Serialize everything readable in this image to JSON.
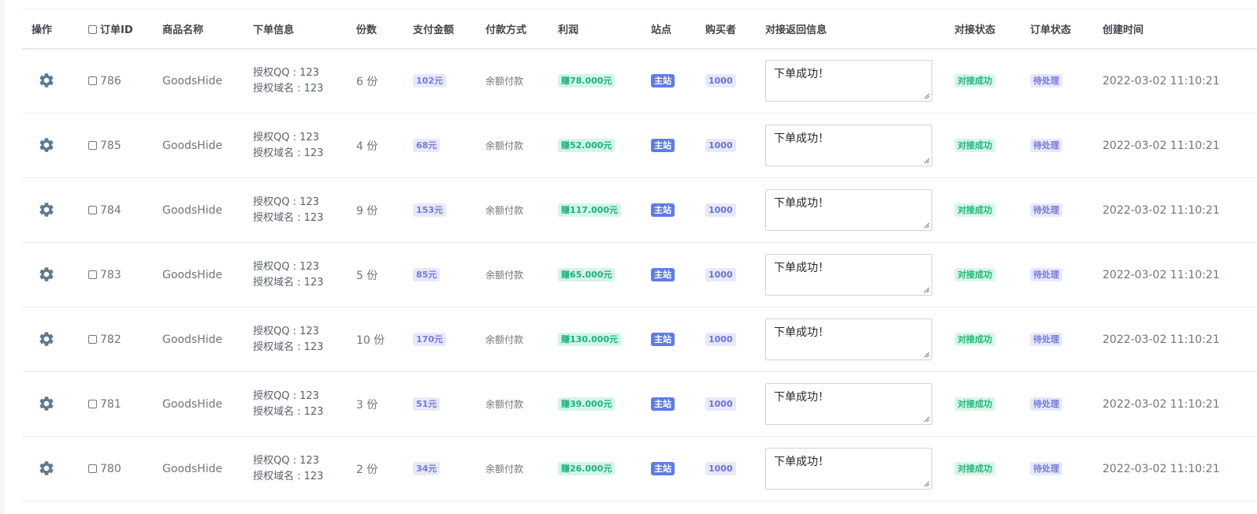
{
  "headers": {
    "op": "操作",
    "order_id": "订单ID",
    "product": "商品名称",
    "order_info": "下单信息",
    "qty": "份数",
    "amount": "支付金额",
    "pay_method": "付款方式",
    "profit": "利润",
    "site": "站点",
    "buyer": "购买者",
    "response": "对接返回信息",
    "dock_status": "对接状态",
    "order_status": "订单状态",
    "created": "创建时间"
  },
  "colors": {
    "gear": "#5e7a8c",
    "profit_green": "#19b37a",
    "site_blue": "#5f7ce6",
    "purple": "#7379e0"
  },
  "icons": {
    "action": "gear-icon"
  },
  "rows": [
    {
      "id": "786",
      "product": "GoodsHide",
      "info_qq": "授权QQ : 123",
      "info_domain": "授权域名 : 123",
      "qty": "6 份",
      "amount": "102元",
      "pay_method": "余额付款",
      "profit": "赚78.000元",
      "site": "主站",
      "buyer": "1000",
      "response": "下单成功！",
      "dock_status": "对接成功",
      "order_status": "待处理",
      "created": "2022-03-02 11:10:21"
    },
    {
      "id": "785",
      "product": "GoodsHide",
      "info_qq": "授权QQ : 123",
      "info_domain": "授权域名 : 123",
      "qty": "4 份",
      "amount": "68元",
      "pay_method": "余额付款",
      "profit": "赚52.000元",
      "site": "主站",
      "buyer": "1000",
      "response": "下单成功！",
      "dock_status": "对接成功",
      "order_status": "待处理",
      "created": "2022-03-02 11:10:21"
    },
    {
      "id": "784",
      "product": "GoodsHide",
      "info_qq": "授权QQ : 123",
      "info_domain": "授权域名 : 123",
      "qty": "9 份",
      "amount": "153元",
      "pay_method": "余额付款",
      "profit": "赚117.000元",
      "site": "主站",
      "buyer": "1000",
      "response": "下单成功！",
      "dock_status": "对接成功",
      "order_status": "待处理",
      "created": "2022-03-02 11:10:21"
    },
    {
      "id": "783",
      "product": "GoodsHide",
      "info_qq": "授权QQ : 123",
      "info_domain": "授权域名 : 123",
      "qty": "5 份",
      "amount": "85元",
      "pay_method": "余额付款",
      "profit": "赚65.000元",
      "site": "主站",
      "buyer": "1000",
      "response": "下单成功！",
      "dock_status": "对接成功",
      "order_status": "待处理",
      "created": "2022-03-02 11:10:21"
    },
    {
      "id": "782",
      "product": "GoodsHide",
      "info_qq": "授权QQ : 123",
      "info_domain": "授权域名 : 123",
      "qty": "10 份",
      "amount": "170元",
      "pay_method": "余额付款",
      "profit": "赚130.000元",
      "site": "主站",
      "buyer": "1000",
      "response": "下单成功！",
      "dock_status": "对接成功",
      "order_status": "待处理",
      "created": "2022-03-02 11:10:21"
    },
    {
      "id": "781",
      "product": "GoodsHide",
      "info_qq": "授权QQ : 123",
      "info_domain": "授权域名 : 123",
      "qty": "3 份",
      "amount": "51元",
      "pay_method": "余额付款",
      "profit": "赚39.000元",
      "site": "主站",
      "buyer": "1000",
      "response": "下单成功！",
      "dock_status": "对接成功",
      "order_status": "待处理",
      "created": "2022-03-02 11:10:21"
    },
    {
      "id": "780",
      "product": "GoodsHide",
      "info_qq": "授权QQ : 123",
      "info_domain": "授权域名 : 123",
      "qty": "2 份",
      "amount": "34元",
      "pay_method": "余额付款",
      "profit": "赚26.000元",
      "site": "主站",
      "buyer": "1000",
      "response": "下单成功！",
      "dock_status": "对接成功",
      "order_status": "待处理",
      "created": "2022-03-02 11:10:21"
    }
  ]
}
